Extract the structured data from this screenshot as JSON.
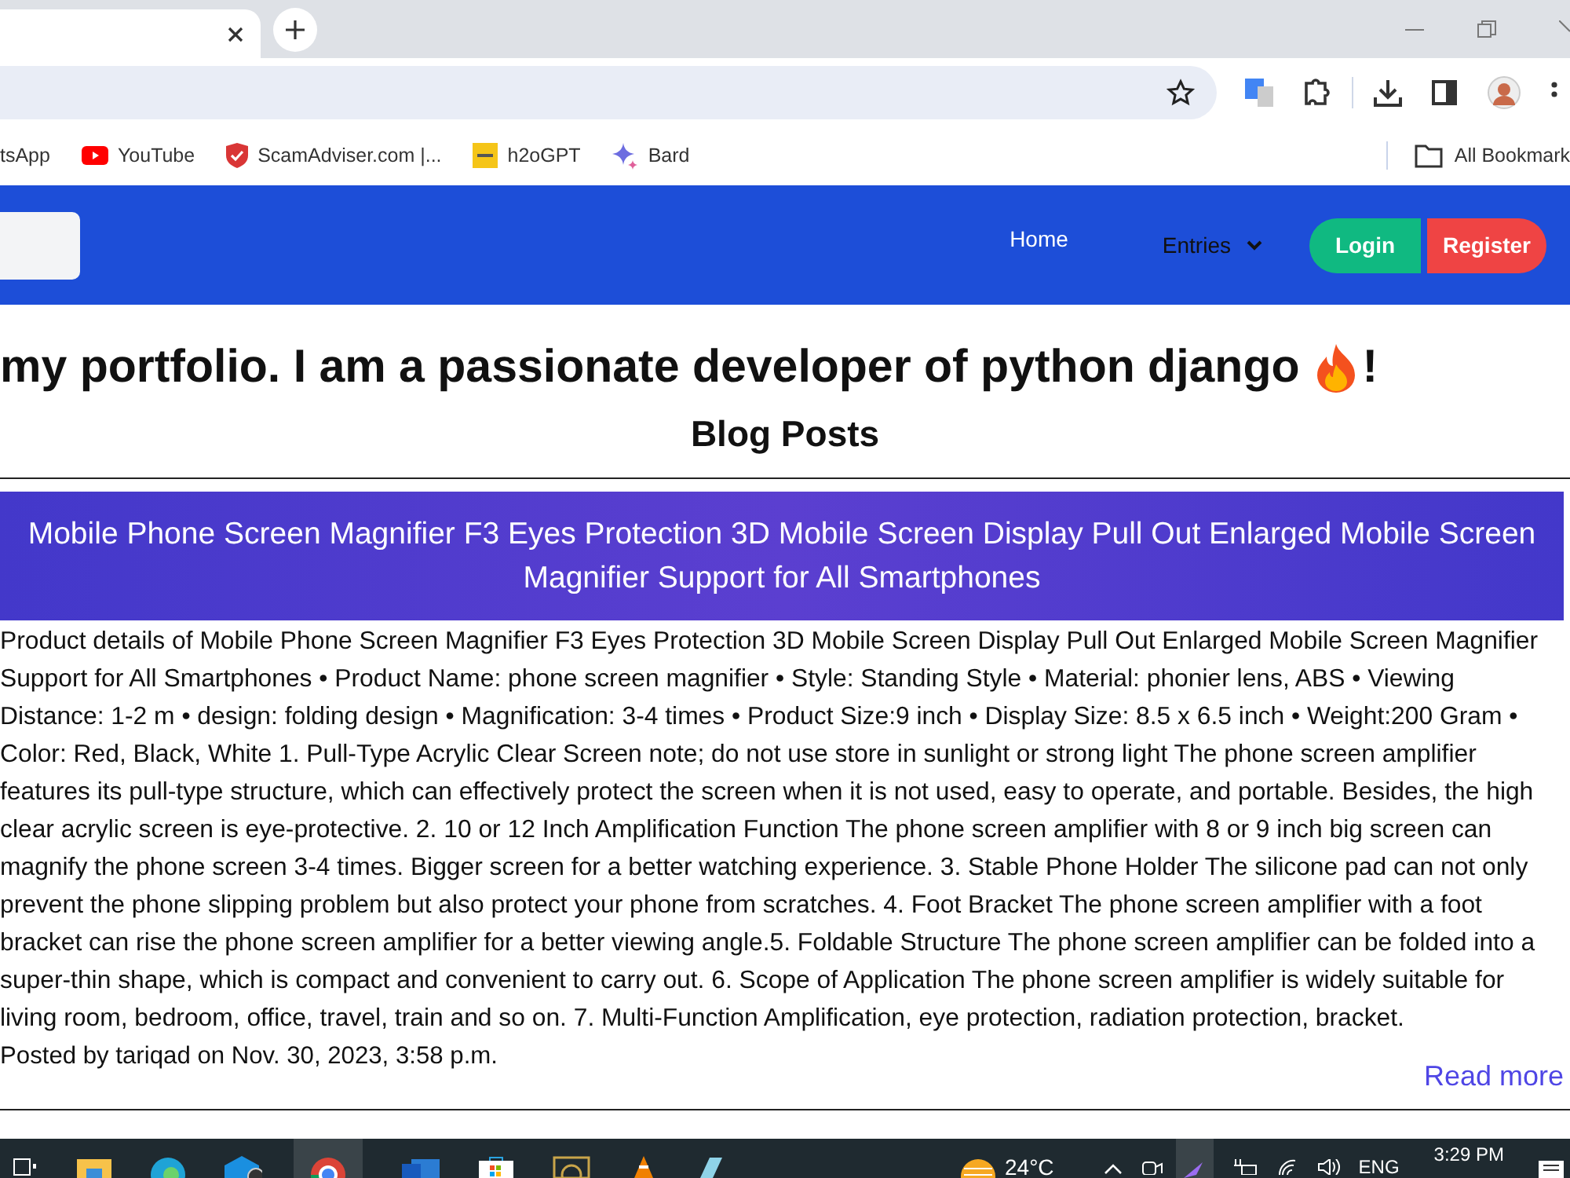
{
  "browser": {
    "bookmarks": [
      {
        "label": "tsApp",
        "kind": "plain"
      },
      {
        "label": "YouTube",
        "kind": "video"
      },
      {
        "label": "ScamAdviser.com |...",
        "kind": "shield"
      },
      {
        "label": "h2oGPT",
        "kind": "tile"
      },
      {
        "label": "Bard",
        "kind": "sparkle"
      }
    ],
    "all_bookmarks": "All Bookmark"
  },
  "navbar": {
    "links": [
      {
        "label": "Home",
        "kind": "link"
      },
      {
        "label": "Entries",
        "kind": "dropdown"
      }
    ],
    "buttons": [
      {
        "label": "Login",
        "kind": "login"
      },
      {
        "label": "Register",
        "kind": "register"
      }
    ]
  },
  "heading": {
    "text": "my portfolio. I am a passionate developer of python django",
    "end": "!"
  },
  "section_title": "Blog Posts",
  "post": {
    "title": "Mobile Phone Screen Magnifier F3 Eyes Protection 3D Mobile Screen Display Pull Out Enlarged Mobile Screen Magnifier Support for All Smartphones",
    "body": "Product details of Mobile Phone Screen Magnifier F3 Eyes Protection 3D Mobile Screen Display Pull Out Enlarged Mobile Screen Magnifier Support for All Smartphones • Product Name: phone screen magnifier • Style: Standing Style • Material: phonier lens, ABS • Viewing Distance: 1-2 m • design: folding design • Magnification: 3-4 times • Product Size:9 inch • Display Size: 8.5 x 6.5 inch • Weight:200 Gram • Color: Red, Black, White 1. Pull-Type Acrylic Clear Screen note; do not use store in sunlight or strong light The phone screen amplifier features its pull-type structure, which can effectively protect the screen when it is not used, easy to operate, and portable. Besides, the high clear acrylic screen is eye-protective. 2. 10 or 12 Inch Amplification Function The phone screen amplifier with 8 or 9 inch big screen can magnify the phone screen 3-4 times. Bigger screen for a better watching experience. 3. Stable Phone Holder The silicone pad can not only prevent the phone slipping problem but also protect your phone from scratches. 4. Foot Bracket The phone screen amplifier with a foot bracket can rise the phone screen amplifier for a better viewing angle.5. Foldable Structure The phone screen amplifier can be folded into a super-thin shape, which is compact and convenient to carry out. 6. Scope of Application The phone screen amplifier is widely suitable for living room, bedroom, office, travel, train and so on. 7. Multi-Function Amplification, eye protection, radiation protection, bracket.",
    "meta": "Posted by tariqad on Nov. 30, 2023, 3:58 p.m.",
    "read_more": "Read more"
  },
  "taskbar": {
    "weather": "24°C",
    "language": "ENG",
    "time": "3:29 PM"
  }
}
